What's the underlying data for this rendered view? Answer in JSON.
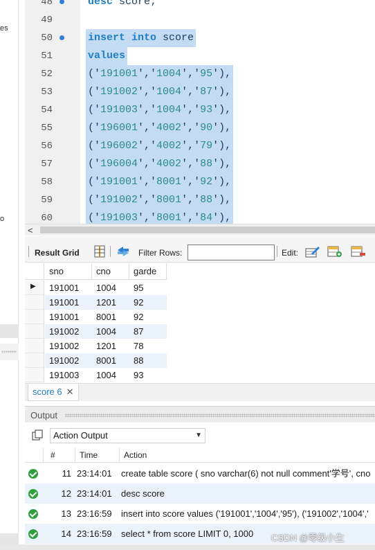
{
  "left_panel": {
    "fragment_top": "es",
    "fragment_mid": "o"
  },
  "editor": {
    "lines": [
      {
        "num": "48",
        "dot": true,
        "parts": [
          {
            "t": "desc",
            "c": "kw"
          },
          {
            "t": " score;",
            "c": "plain"
          }
        ],
        "hl": false
      },
      {
        "num": "49",
        "dot": false,
        "parts": [],
        "hl": false
      },
      {
        "num": "50",
        "dot": true,
        "parts": [
          {
            "t": "insert into",
            "c": "kw"
          },
          {
            "t": " score",
            "c": "plain"
          }
        ],
        "hl": true
      },
      {
        "num": "51",
        "dot": false,
        "parts": [
          {
            "t": "values",
            "c": "kw"
          }
        ],
        "hl": true
      },
      {
        "num": "52",
        "dot": false,
        "parts": [
          {
            "t": "('",
            "c": "plain"
          },
          {
            "t": "191001",
            "c": "str"
          },
          {
            "t": "','",
            "c": "plain"
          },
          {
            "t": "1004",
            "c": "str"
          },
          {
            "t": "','",
            "c": "plain"
          },
          {
            "t": "95",
            "c": "str"
          },
          {
            "t": "'),",
            "c": "plain"
          }
        ],
        "hl": true
      },
      {
        "num": "53",
        "dot": false,
        "parts": [
          {
            "t": "('",
            "c": "plain"
          },
          {
            "t": "191002",
            "c": "str"
          },
          {
            "t": "','",
            "c": "plain"
          },
          {
            "t": "1004",
            "c": "str"
          },
          {
            "t": "','",
            "c": "plain"
          },
          {
            "t": "87",
            "c": "str"
          },
          {
            "t": "'),",
            "c": "plain"
          }
        ],
        "hl": true
      },
      {
        "num": "54",
        "dot": false,
        "parts": [
          {
            "t": "('",
            "c": "plain"
          },
          {
            "t": "191003",
            "c": "str"
          },
          {
            "t": "','",
            "c": "plain"
          },
          {
            "t": "1004",
            "c": "str"
          },
          {
            "t": "','",
            "c": "plain"
          },
          {
            "t": "93",
            "c": "str"
          },
          {
            "t": "'),",
            "c": "plain"
          }
        ],
        "hl": true
      },
      {
        "num": "55",
        "dot": false,
        "parts": [
          {
            "t": "('",
            "c": "plain"
          },
          {
            "t": "196001",
            "c": "str"
          },
          {
            "t": "','",
            "c": "plain"
          },
          {
            "t": "4002",
            "c": "str"
          },
          {
            "t": "','",
            "c": "plain"
          },
          {
            "t": "90",
            "c": "str"
          },
          {
            "t": "'),",
            "c": "plain"
          }
        ],
        "hl": true
      },
      {
        "num": "56",
        "dot": false,
        "parts": [
          {
            "t": "('",
            "c": "plain"
          },
          {
            "t": "196002",
            "c": "str"
          },
          {
            "t": "','",
            "c": "plain"
          },
          {
            "t": "4002",
            "c": "str"
          },
          {
            "t": "','",
            "c": "plain"
          },
          {
            "t": "79",
            "c": "str"
          },
          {
            "t": "'),",
            "c": "plain"
          }
        ],
        "hl": true
      },
      {
        "num": "57",
        "dot": false,
        "parts": [
          {
            "t": "('",
            "c": "plain"
          },
          {
            "t": "196004",
            "c": "str"
          },
          {
            "t": "','",
            "c": "plain"
          },
          {
            "t": "4002",
            "c": "str"
          },
          {
            "t": "','",
            "c": "plain"
          },
          {
            "t": "88",
            "c": "str"
          },
          {
            "t": "'),",
            "c": "plain"
          }
        ],
        "hl": true
      },
      {
        "num": "58",
        "dot": false,
        "parts": [
          {
            "t": "('",
            "c": "plain"
          },
          {
            "t": "191001",
            "c": "str"
          },
          {
            "t": "','",
            "c": "plain"
          },
          {
            "t": "8001",
            "c": "str"
          },
          {
            "t": "','",
            "c": "plain"
          },
          {
            "t": "92",
            "c": "str"
          },
          {
            "t": "'),",
            "c": "plain"
          }
        ],
        "hl": true
      },
      {
        "num": "59",
        "dot": false,
        "parts": [
          {
            "t": "('",
            "c": "plain"
          },
          {
            "t": "191002",
            "c": "str"
          },
          {
            "t": "','",
            "c": "plain"
          },
          {
            "t": "8001",
            "c": "str"
          },
          {
            "t": "','",
            "c": "plain"
          },
          {
            "t": "88",
            "c": "str"
          },
          {
            "t": "'),",
            "c": "plain"
          }
        ],
        "hl": true
      },
      {
        "num": "60",
        "dot": false,
        "parts": [
          {
            "t": "('",
            "c": "plain"
          },
          {
            "t": "191003",
            "c": "str"
          },
          {
            "t": "','",
            "c": "plain"
          },
          {
            "t": "8001",
            "c": "str"
          },
          {
            "t": "','",
            "c": "plain"
          },
          {
            "t": "84",
            "c": "str"
          },
          {
            "t": "'),",
            "c": "plain"
          }
        ],
        "hl": true
      }
    ]
  },
  "scrollbar": {
    "left_arrow": "<"
  },
  "result_toolbar": {
    "result_grid_label": "Result Grid",
    "filter_rows_label": "Filter Rows:",
    "filter_value": "",
    "edit_label": "Edit:"
  },
  "grid": {
    "columns": [
      "sno",
      "cno",
      "garde"
    ],
    "rows": [
      [
        "191001",
        "1004",
        "95"
      ],
      [
        "191001",
        "1201",
        "92"
      ],
      [
        "191001",
        "8001",
        "92"
      ],
      [
        "191002",
        "1004",
        "87"
      ],
      [
        "191002",
        "1201",
        "78"
      ],
      [
        "191002",
        "8001",
        "88"
      ],
      [
        "191003",
        "1004",
        "93"
      ]
    ],
    "current_row_marker": "▶"
  },
  "result_tab": {
    "label": "score 6",
    "close": "✕"
  },
  "output": {
    "title": "Output",
    "select_value": "Action Output",
    "columns": [
      "#",
      "Time",
      "Action"
    ],
    "rows": [
      {
        "n": "11",
        "time": "23:14:01",
        "action": "create table score ( sno varchar(6) not null comment'学号', cno"
      },
      {
        "n": "12",
        "time": "23:14:01",
        "action": "desc score"
      },
      {
        "n": "13",
        "time": "23:16:59",
        "action": "insert into score values ('191001','1004','95'), ('191002','1004','"
      },
      {
        "n": "14",
        "time": "23:16:59",
        "action": "select * from score LIMIT 0, 1000"
      }
    ]
  },
  "watermark": "CSDN @零级小生",
  "colors": {
    "keyword": "#1f7fc4",
    "string": "#2a8a8a",
    "selection": "#c4dcf3",
    "success": "#2f9e3d"
  }
}
